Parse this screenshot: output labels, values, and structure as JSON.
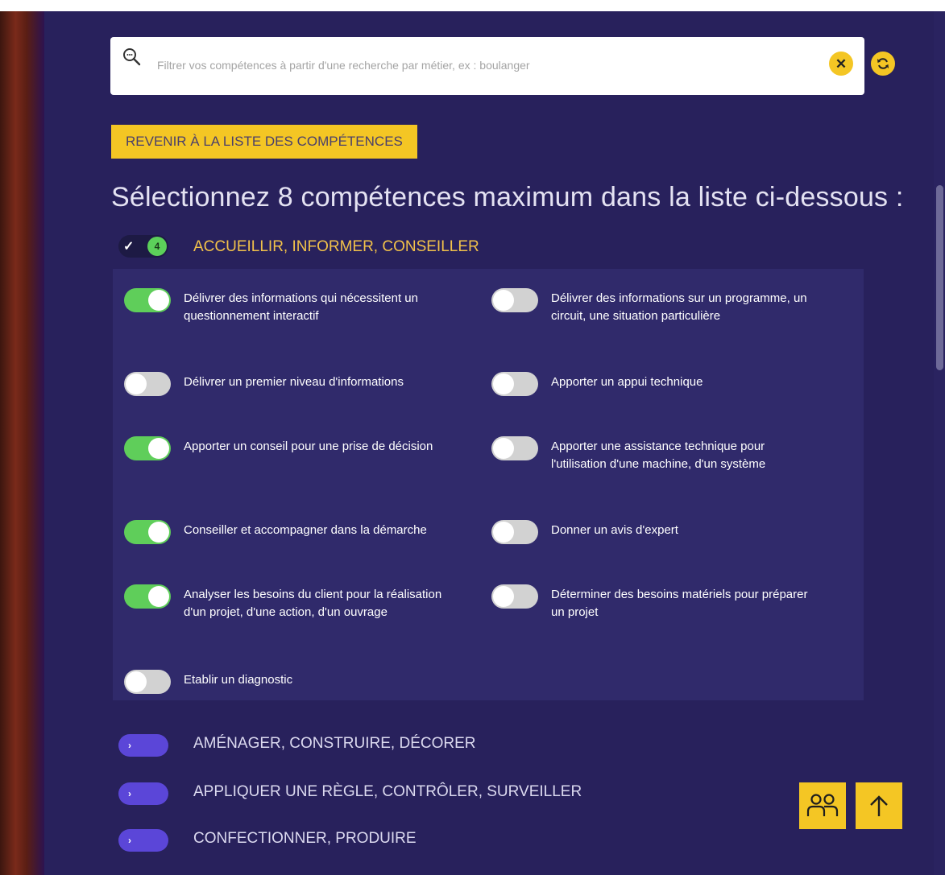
{
  "search": {
    "placeholder": "Filtrer vos compétences à partir d'une recherche par métier, ex : boulanger",
    "clear_icon": "close-icon",
    "refresh_icon": "refresh-icon"
  },
  "back_button": "REVENIR À LA LISTE DES COMPÉTENCES",
  "page_title": "Sélectionnez 8 compétences maximum dans la liste ci-dessous :",
  "open_category": {
    "label": "ACCUEILLIR, INFORMER, CONSEILLER",
    "count": "4"
  },
  "skills": [
    {
      "label": "Délivrer des informations qui nécessitent un questionnement interactif",
      "selected": true
    },
    {
      "label": "Délivrer des informations sur un programme, un circuit, une situation particulière",
      "selected": false
    },
    {
      "label": "Délivrer un premier niveau d'informations",
      "selected": false
    },
    {
      "label": "Apporter un appui technique",
      "selected": false
    },
    {
      "label": "Apporter un conseil pour une prise de décision",
      "selected": true
    },
    {
      "label": "Apporter une assistance technique pour l'utilisation d'une machine, d'un système",
      "selected": false
    },
    {
      "label": "Conseiller et accompagner dans la démarche",
      "selected": true
    },
    {
      "label": "Donner un avis d'expert",
      "selected": false
    },
    {
      "label": "Analyser les besoins du client pour la réalisation d'un projet, d'une action, d'un ouvrage",
      "selected": true
    },
    {
      "label": "Déterminer des besoins matériels pour préparer un projet",
      "selected": false
    },
    {
      "label": "Etablir un diagnostic",
      "selected": false
    }
  ],
  "categories": [
    {
      "label": "AMÉNAGER, CONSTRUIRE, DÉCORER"
    },
    {
      "label": "APPLIQUER UNE RÈGLE, CONTRÔLER, SURVEILLER"
    },
    {
      "label": "CONFECTIONNER, PRODUIRE"
    }
  ],
  "floating": {
    "users_icon": "users-icon",
    "top_icon": "arrow-up-icon"
  },
  "colors": {
    "background": "#28215c",
    "accent": "#f4c624",
    "toggle_on": "#5fce5a",
    "toggle_off": "#d2d2d2",
    "category_toggle": "#5b46d8"
  }
}
